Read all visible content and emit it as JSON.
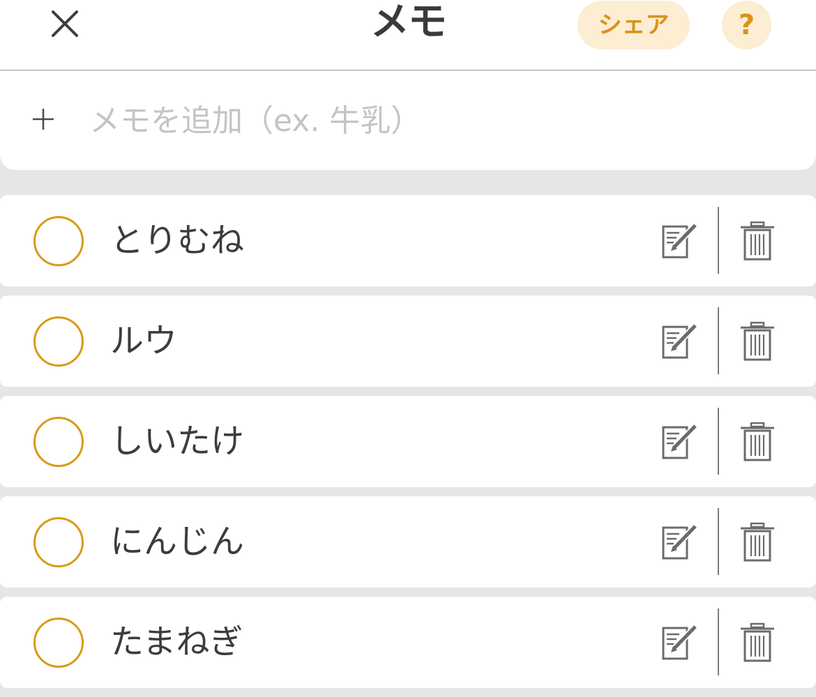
{
  "header": {
    "title": "メモ",
    "share_label": "シェア",
    "help_label": "?",
    "close_icon": "close-icon"
  },
  "add_memo": {
    "placeholder": "メモを追加（ex. 牛乳）",
    "value": "",
    "icon": "plus-icon"
  },
  "items": [
    {
      "label": "とりむね",
      "checked": false
    },
    {
      "label": "ルウ",
      "checked": false
    },
    {
      "label": "しいたけ",
      "checked": false
    },
    {
      "label": "にんじん",
      "checked": false
    },
    {
      "label": "たまねぎ",
      "checked": false
    }
  ],
  "colors": {
    "accent": "#d99a15",
    "accent_bg": "#fcedd3",
    "background": "#e6e6e6",
    "text": "#3c3c3c",
    "icon": "#6b6b6b"
  }
}
